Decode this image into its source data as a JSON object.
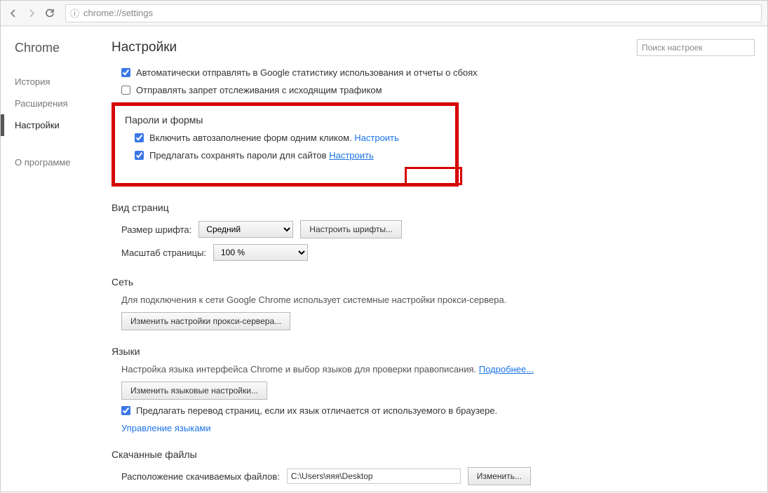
{
  "toolbar": {
    "url_proto": "chrome://settings",
    "url_suffix": ""
  },
  "sidebar": {
    "brand": "Chrome",
    "items": [
      {
        "label": "История",
        "active": false
      },
      {
        "label": "Расширения",
        "active": false
      },
      {
        "label": "Настройки",
        "active": true
      }
    ],
    "about": "О программе"
  },
  "header": {
    "title": "Настройки",
    "search_placeholder": "Поиск настроек"
  },
  "top_checks": {
    "stats_label": "Автоматически отправлять в Google статистику использования и отчеты о сбоях",
    "stats_checked": true,
    "dnt_label": "Отправлять запрет отслеживания с исходящим трафиком",
    "dnt_checked": false
  },
  "passwords": {
    "title": "Пароли и формы",
    "autofill_checked": true,
    "autofill_label": "Включить автозаполнение форм одним кликом.",
    "autofill_link": "Настроить",
    "savepw_checked": true,
    "savepw_label": "Предлагать сохранять пароли для сайтов",
    "savepw_link": "Настроить"
  },
  "appearance": {
    "title": "Вид страниц",
    "font_label": "Размер шрифта:",
    "font_value": "Средний",
    "font_btn": "Настроить шрифты...",
    "zoom_label": "Масштаб страницы:",
    "zoom_value": "100 %"
  },
  "network": {
    "title": "Сеть",
    "desc": "Для подключения к сети Google Chrome использует системные настройки прокси-сервера.",
    "btn": "Изменить настройки прокси-сервера..."
  },
  "languages": {
    "title": "Языки",
    "desc_prefix": "Настройка языка интерфейса Chrome и выбор языков для проверки правописания.",
    "desc_link": "Подробнее...",
    "btn": "Изменить языковые настройки...",
    "translate_checked": true,
    "translate_label": "Предлагать перевод страниц, если их язык отличается от используемого в браузере.",
    "manage_link": "Управление языками"
  },
  "downloads": {
    "title": "Скачанные файлы",
    "path_label": "Расположение скачиваемых файлов:",
    "path_value": "C:\\Users\\яяя\\Desktop",
    "change_btn": "Изменить..."
  }
}
